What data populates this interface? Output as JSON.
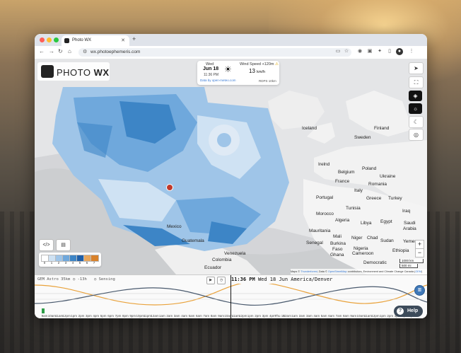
{
  "browser": {
    "tab_title": "Photo WX",
    "url": "wx.photoephemeris.com"
  },
  "app": {
    "logo_text_a": "PHOTO",
    "logo_text_b": "WX"
  },
  "info_card": {
    "day": "Wed",
    "date": "Jun 18",
    "time": "11:36 PM",
    "weather_icon": "sun-icon",
    "wind_label": "Wind Speed +120m",
    "wind_value": "13",
    "wind_unit": "km/h",
    "data_credit": "Data by open-meteo.com",
    "model_tag": "RDPS 10km"
  },
  "map": {
    "places": [
      {
        "name": "Iceland"
      },
      {
        "name": "Finland"
      },
      {
        "name": "Sweden"
      },
      {
        "name": "Irelnd"
      },
      {
        "name": "Belgium"
      },
      {
        "name": "Poland"
      },
      {
        "name": "France"
      },
      {
        "name": "Ukraine"
      },
      {
        "name": "Romania"
      },
      {
        "name": "Portugal"
      },
      {
        "name": "Italy"
      },
      {
        "name": "Turkey"
      },
      {
        "name": "Greece"
      },
      {
        "name": "Tunisia"
      },
      {
        "name": "Iraq"
      },
      {
        "name": "Morocco"
      },
      {
        "name": "Algeria"
      },
      {
        "name": "Libya"
      },
      {
        "name": "Egypt"
      },
      {
        "name": "Saudi"
      },
      {
        "name": "Arabia"
      },
      {
        "name": "Mauritania"
      },
      {
        "name": "Mali"
      },
      {
        "name": "Niger"
      },
      {
        "name": "Chad"
      },
      {
        "name": "Sudan"
      },
      {
        "name": "Yemen"
      },
      {
        "name": "Senegal"
      },
      {
        "name": "Burkina"
      },
      {
        "name": "Faso"
      },
      {
        "name": "Ghana"
      },
      {
        "name": "Nigeria"
      },
      {
        "name": "Ethiopia"
      },
      {
        "name": "Cameroon"
      },
      {
        "name": "Democratic"
      },
      {
        "name": "Mexico"
      },
      {
        "name": "Guatemala"
      },
      {
        "name": "Venezuela"
      },
      {
        "name": "Colombia"
      },
      {
        "name": "Ecuador"
      }
    ],
    "attribution_prefix": "Maps ©",
    "attribution_link1": "Thunderforest",
    "attribution_mid": ", Data ©",
    "attribution_link2": "OpenStreetMap",
    "attribution_suffix": "contributors, Environment and Climate Change Canada (",
    "attribution_link3": "GEM",
    "attribution_end": ")",
    "scale_km": "1000 km",
    "scale_mi": "500 mi"
  },
  "legend": {
    "labels": [
      "0",
      "1",
      "2",
      "3",
      "4",
      "5",
      "6",
      "7"
    ],
    "colors": [
      "#ffffff",
      "#cfe2f3",
      "#9fc5e8",
      "#6fa8dc",
      "#3d85c6",
      "#1f5fa8",
      "#e8a65c",
      "#d9822b"
    ]
  },
  "side_buttons": [
    {
      "icon": "locate-arrow-icon"
    },
    {
      "icon": "fullscreen-icon"
    },
    {
      "icon": "layers-icon"
    },
    {
      "icon": "sun-icon"
    },
    {
      "icon": "moon-icon"
    },
    {
      "icon": "target-icon"
    }
  ],
  "view_buttons": [
    {
      "icon": "embed-code-icon"
    },
    {
      "icon": "document-icon"
    }
  ],
  "zoom": {
    "in": "+",
    "out": "−"
  },
  "timeline": {
    "model": "GEM Astro 35km",
    "offset": "-13h",
    "mode": "Sensing",
    "current_time": "11:36 PM",
    "current_rest": "Wed 18 Jun America/Denver",
    "hours": [
      "9am",
      "10am",
      "11am",
      "12pm",
      "1pm",
      "2pm",
      "3pm",
      "4pm",
      "5pm",
      "6pm",
      "7pm",
      "8pm",
      "9pm",
      "10pm",
      "11pm",
      "12am",
      "1am",
      "2am",
      "3am",
      "4am",
      "5am",
      "6am",
      "7am",
      "8am",
      "9am",
      "10am",
      "11am",
      "12pm",
      "1pm",
      "2pm",
      "3pm",
      "4pm",
      "Thu 18",
      "12am",
      "1am",
      "2am",
      "3am",
      "4am",
      "5am",
      "6am",
      "7am",
      "8am",
      "9am",
      "10am",
      "11am",
      "12pm",
      "1pm",
      "2pm",
      "3pm",
      "4pm",
      "5pm"
    ],
    "colors": {
      "sun": "#e9a23b",
      "moon": "#4a5a6e"
    }
  },
  "help_label": "Help"
}
